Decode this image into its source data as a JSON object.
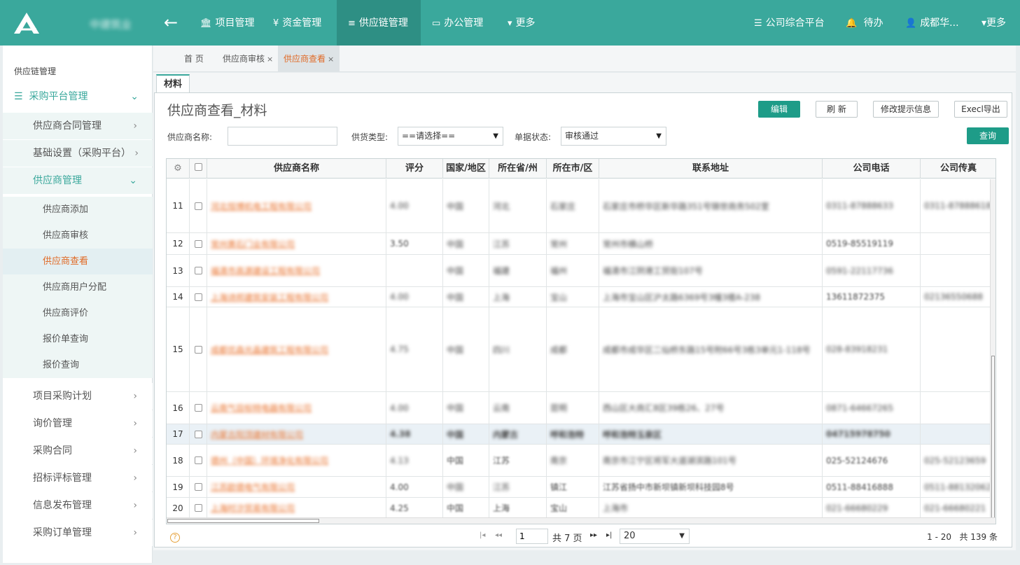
{
  "brand": {
    "company": "中建筑业",
    "accent": "#3aa89c",
    "nav_active": "#2e8f84",
    "link_color": "#e8702a"
  },
  "topnav": {
    "items": [
      {
        "label": "项目管理",
        "icon": "bank-icon"
      },
      {
        "label": "资金管理",
        "icon": "yen-icon"
      },
      {
        "label": "供应链管理",
        "icon": "database-icon"
      },
      {
        "label": "办公管理",
        "icon": "monitor-icon"
      },
      {
        "label": "更多",
        "icon": "caret-down-icon"
      }
    ],
    "right": {
      "platform": "公司综合平台",
      "todo": "待办",
      "user": "成都华...",
      "more": "更多"
    }
  },
  "sidebar": {
    "root": "供应链管理",
    "group": "采购平台管理",
    "items": [
      {
        "label": "供应商合同管理"
      },
      {
        "label": "基础设置（采购平台）"
      },
      {
        "label": "供应商管理"
      },
      {
        "label": "项目采购计划"
      },
      {
        "label": "询价管理"
      },
      {
        "label": "采购合同"
      },
      {
        "label": "招标评标管理"
      },
      {
        "label": "信息发布管理"
      },
      {
        "label": "采购订单管理"
      }
    ],
    "subitems": [
      {
        "label": "供应商添加"
      },
      {
        "label": "供应商审核"
      },
      {
        "label": "供应商查看"
      },
      {
        "label": "供应商用户分配"
      },
      {
        "label": "供应商评价"
      },
      {
        "label": "报价单查询"
      },
      {
        "label": "报价查询"
      }
    ]
  },
  "tabs": [
    {
      "label": "首 页"
    },
    {
      "label": "供应商审核",
      "close": "×"
    },
    {
      "label": "供应商查看",
      "close": "×"
    }
  ],
  "subtab": "材料",
  "page": {
    "title": "供应商查看_材料",
    "buttons": {
      "edit": "编辑",
      "refresh": "刷 新",
      "modify_tip": "修改提示信息",
      "export": "Execl导出",
      "query": "查询"
    },
    "filters": {
      "name_label": "供应商名称:",
      "name_value": "",
      "type_label": "供货类型:",
      "type_value": "==请选择==",
      "status_label": "单据状态:",
      "status_value": "审核通过"
    }
  },
  "grid": {
    "columns": [
      "供应商名称",
      "评分",
      "国家/地区",
      "所在省/州",
      "所在市/区",
      "联系地址",
      "公司电话",
      "公司传真"
    ],
    "rows": [
      {
        "no": "11",
        "name": "河北恒博机电工程有限公司",
        "score": "4.00",
        "country": "中国",
        "province": "河北",
        "city": "石家庄",
        "address": "石家庄市桥华区新华路351号锦世商务502室",
        "phone": "0311-87888633",
        "fax": "0311-87888618"
      },
      {
        "no": "12",
        "name": "常州黄石门业有限公司",
        "score": "3.50",
        "country": "中国",
        "province": "江苏",
        "city": "常州",
        "address": "常州市横山桥",
        "phone": "0519-85519119",
        "fax": ""
      },
      {
        "no": "13",
        "name": "福清市高源建设工程有限公司",
        "score": "",
        "country": "中国",
        "province": "福建",
        "city": "福州",
        "address": "福清市江阴港工贸街107号",
        "phone": "0591-22117736",
        "fax": ""
      },
      {
        "no": "14",
        "name": "上海诗邦建筑安装工程有限公司",
        "score": "4.00",
        "country": "中国",
        "province": "上海",
        "city": "宝山",
        "address": "上海市宝山区沪太路6369号3幢3楼A-238",
        "phone": "13611872375",
        "fax": "02136550688"
      },
      {
        "no": "15",
        "name": "成都优森光晶建筑工程有限公司",
        "score": "4.75",
        "country": "中国",
        "province": "四川",
        "city": "成都",
        "address": "成都市成华区二仙桥东路15号附66号3栋3单元1-118号",
        "phone": "028-83918231",
        "fax": ""
      },
      {
        "no": "16",
        "name": "云南气目标特电器有限公司",
        "score": "4.00",
        "country": "中国",
        "province": "云南",
        "city": "昆明",
        "address": "西山区大商汇8区39栋26、27号",
        "phone": "0871-64667265",
        "fax": ""
      },
      {
        "no": "17",
        "name": "内蒙古阳顶建材有限公司",
        "score": "4.38",
        "country": "中国",
        "province": "内蒙古",
        "city": "呼和浩特",
        "address": "呼和浩特玉泉区",
        "phone": "04715978750",
        "fax": ""
      },
      {
        "no": "18",
        "name": "德州（中国）环境净化有限公司",
        "score": "4.13",
        "country": "中国",
        "province": "江苏",
        "city": "南京",
        "address": "南京市江宁区将军大道湖滨路101号",
        "phone": "025-52124676",
        "fax": "025-52123659"
      },
      {
        "no": "19",
        "name": "江苏欧德电气有限公司",
        "score": "4.00",
        "country": "中国",
        "province": "江苏",
        "city": "镇江",
        "address": "江苏省扬中市新坝镇新坝科技园8号",
        "phone": "0511-88416888",
        "fax": "0511-88132062"
      },
      {
        "no": "20",
        "name": "上海时汐贸易有限公司",
        "score": "4.25",
        "country": "中国",
        "province": "上海",
        "city": "宝山",
        "address": "上海市",
        "phone": "021-66680229",
        "fax": "021-66680221"
      }
    ]
  },
  "pager": {
    "current_page": "1",
    "total_pages": "共 7 页",
    "page_size": "20",
    "range": "1 - 20   共 139 条",
    "help": "?"
  }
}
